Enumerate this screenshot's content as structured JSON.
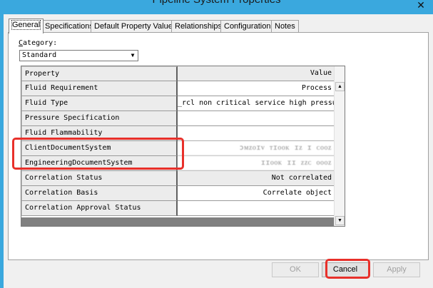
{
  "window": {
    "title": "Pipeline System Properties",
    "close_glyph": "✕"
  },
  "tabs": [
    {
      "label": "General"
    },
    {
      "label": "Specifications"
    },
    {
      "label": "Default Property Values"
    },
    {
      "label": "Relationships"
    },
    {
      "label": "Configuration"
    },
    {
      "label": "Notes"
    }
  ],
  "category": {
    "label_accel": "C",
    "label_rest": "ategory:",
    "selected": "Standard",
    "arrow_glyph": "▼"
  },
  "grid": {
    "header": {
      "property": "Property",
      "value": "Value"
    },
    "rows": [
      {
        "property": "Fluid Requirement",
        "value": "Process"
      },
      {
        "property": "Fluid Type",
        "value": "_rcl non critical service high pressure"
      },
      {
        "property": "Pressure Specification",
        "value": ""
      },
      {
        "property": "Fluid Flammability",
        "value": ""
      },
      {
        "property": "ClientDocumentSystem",
        "value": "ɔᴍᴢᴏɪᴠ ᴛɪᴏᴏᴋ ɪᴢ ɪ ᴄᴏᴏᴢ"
      },
      {
        "property": "EngineeringDocumentSystem",
        "value": "ɪɪᴏᴏᴋ ɪɪ ᴢᴢᴄ ᴏᴏᴏᴢ"
      },
      {
        "property": "Correlation Status",
        "value": "Not correlated"
      },
      {
        "property": "Correlation Basis",
        "value": "Correlate object"
      },
      {
        "property": "Correlation Approval Status",
        "value": ""
      }
    ],
    "scroll_up_glyph": "▲",
    "scroll_down_glyph": "▼"
  },
  "buttons": {
    "ok": "OK",
    "cancel": "Cancel",
    "apply": "Apply"
  },
  "colors": {
    "titlebar": "#3aa8de",
    "annotation": "#e8302a"
  }
}
